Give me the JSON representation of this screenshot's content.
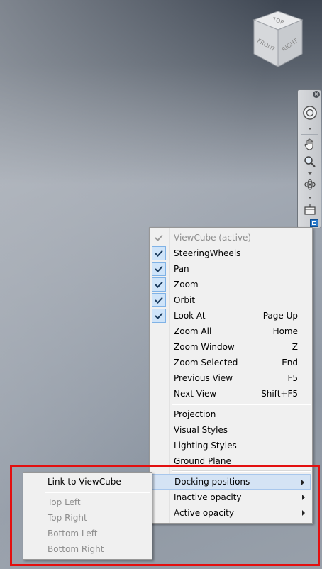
{
  "viewcube": {
    "faces": {
      "top": "TOP",
      "front": "FRONT",
      "right": "RIGHT"
    }
  },
  "navbar": {
    "icons": [
      "close-icon",
      "steering-wheel-icon",
      "pan-hand-icon",
      "zoom-magnifier-icon",
      "orbit-icon",
      "look-at-icon",
      "customize-menu-icon"
    ]
  },
  "menu": {
    "items": [
      {
        "label": "ViewCube (active)",
        "shortcut": "",
        "checked": true,
        "disabled": true
      },
      {
        "label": "SteeringWheels",
        "shortcut": "",
        "checked": true
      },
      {
        "label": "Pan",
        "shortcut": "",
        "checked": true
      },
      {
        "label": "Zoom",
        "shortcut": "",
        "checked": true
      },
      {
        "label": "Orbit",
        "shortcut": "",
        "checked": true
      },
      {
        "label": "Look At",
        "shortcut": "Page Up",
        "checked": true
      },
      {
        "label": "Zoom All",
        "shortcut": "Home"
      },
      {
        "label": "Zoom Window",
        "shortcut": "Z"
      },
      {
        "label": "Zoom Selected",
        "shortcut": "End"
      },
      {
        "label": "Previous View",
        "shortcut": "F5"
      },
      {
        "label": "Next View",
        "shortcut": "Shift+F5"
      },
      {
        "label": "Projection"
      },
      {
        "label": "Visual Styles"
      },
      {
        "label": "Lighting Styles"
      },
      {
        "label": "Ground Plane"
      },
      {
        "label": "Docking positions",
        "submenu": true,
        "highlighted": true
      },
      {
        "label": "Inactive opacity",
        "submenu": true
      },
      {
        "label": "Active opacity",
        "submenu": true
      }
    ]
  },
  "submenu": {
    "items": [
      {
        "label": "Link to ViewCube"
      },
      {
        "label": "Top Left",
        "disabled": true
      },
      {
        "label": "Top Right",
        "disabled": true
      },
      {
        "label": "Bottom Left",
        "disabled": true
      },
      {
        "label": "Bottom Right",
        "disabled": true
      }
    ]
  },
  "colors": {
    "highlight_box": "#e30f0f",
    "check_bg": "#cfe4f9",
    "menu_hover": "#d4e3f4",
    "nav_accent": "#2a79c9"
  }
}
